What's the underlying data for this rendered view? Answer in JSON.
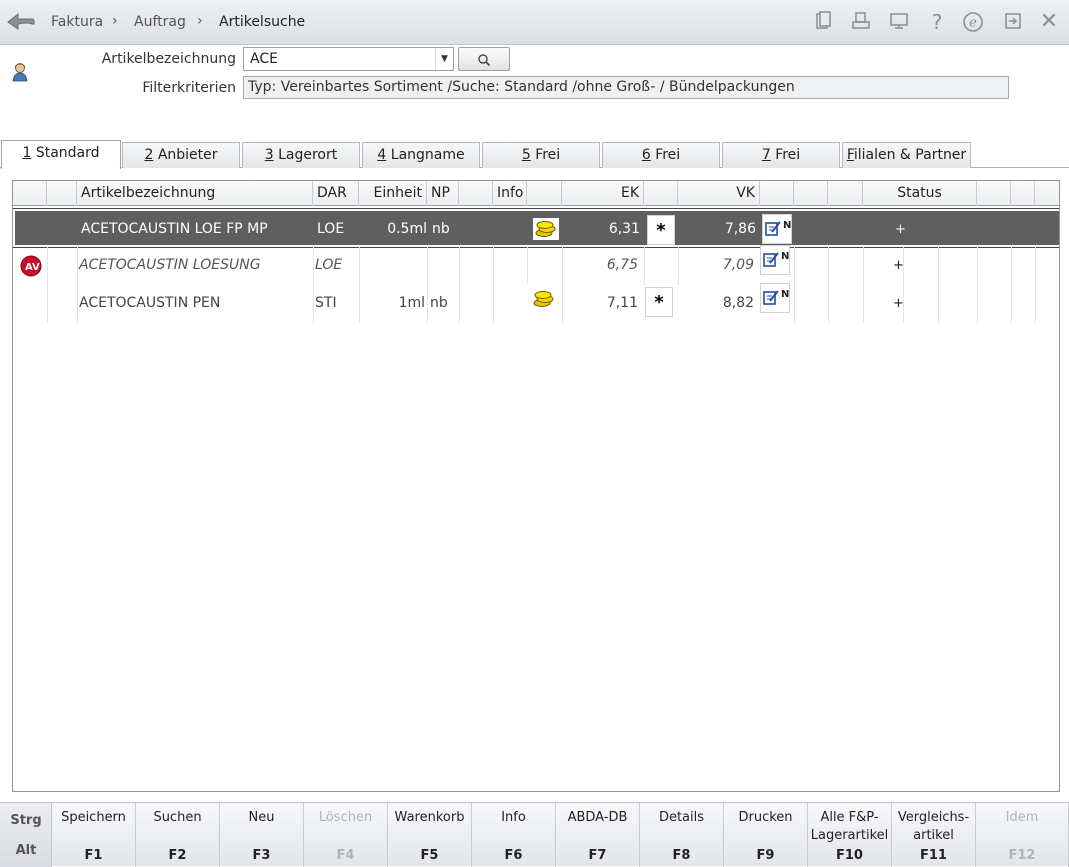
{
  "breadcrumb": [
    "Faktura",
    "Auftrag",
    "Artikelsuche"
  ],
  "toolbar_icons": [
    "clipboard-icon",
    "printer-icon",
    "monitor-icon",
    "help-icon",
    "info-e-icon",
    "exit-icon",
    "close-icon"
  ],
  "form": {
    "artikel_label": "Artikelbezeichnung",
    "artikel_value": "ACE",
    "filter_label": "Filterkriterien",
    "filter_value": "Typ: Vereinbartes Sortiment /Suche: Standard /ohne Groß- / Bündelpackungen"
  },
  "tabs": [
    {
      "num": "1",
      "label": "Standard"
    },
    {
      "num": "2",
      "label": "Anbieter"
    },
    {
      "num": "3",
      "label": "Lagerort"
    },
    {
      "num": "4",
      "label": "Langname"
    },
    {
      "num": "5",
      "label": "Frei"
    },
    {
      "num": "6",
      "label": "Frei"
    },
    {
      "num": "7",
      "label": "Frei"
    },
    {
      "num": "F",
      "label": "ilialen & Partner"
    }
  ],
  "columns": {
    "name": "Artikelbezeichnung",
    "dar": "DAR",
    "einheit": "Einheit",
    "np": "NP",
    "info": "Info",
    "ek": "EK",
    "vk": "VK",
    "status": "Status"
  },
  "rows": [
    {
      "name": "ACETOCAUSTIN LOE FP MP",
      "dar": "LOE",
      "einheit": "0.5ml",
      "np": "nb",
      "ek": "6,31",
      "star": "*",
      "vk": "7,86",
      "note": "N",
      "status": "+"
    },
    {
      "name": "ACETOCAUSTIN LOESUNG",
      "dar": "LOE",
      "einheit": "",
      "np": "",
      "ek": "6,75",
      "star": "",
      "vk": "7,09",
      "note": "N",
      "status": "+"
    },
    {
      "name": "ACETOCAUSTIN PEN",
      "dar": "STI",
      "einheit": "1ml",
      "np": "nb",
      "ek": "7,11",
      "star": "*",
      "vk": "8,82",
      "note": "N",
      "status": "+"
    }
  ],
  "modifiers": {
    "strg": "Strg",
    "alt": "Alt"
  },
  "fkeys": [
    {
      "label": "Speichern",
      "key": "F1"
    },
    {
      "label": "Suchen",
      "key": "F2"
    },
    {
      "label": "Neu",
      "key": "F3"
    },
    {
      "label": "Löschen",
      "key": "F4"
    },
    {
      "label": "Warenkorb",
      "key": "F5"
    },
    {
      "label": "Info",
      "key": "F6"
    },
    {
      "label": "ABDA-DB",
      "key": "F7"
    },
    {
      "label": "Details",
      "key": "F8"
    },
    {
      "label": "Drucken",
      "key": "F9"
    },
    {
      "label": "Alle F&P-\nLagerartikel",
      "key": "F10"
    },
    {
      "label": "Vergleichs-\nartikel",
      "key": "F11"
    },
    {
      "label": "Idem",
      "key": "F12"
    }
  ]
}
